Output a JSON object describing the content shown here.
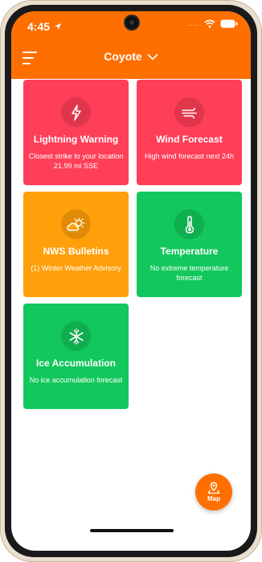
{
  "status": {
    "time": "4:45",
    "signal_dots": "...."
  },
  "header": {
    "location": "Coyote"
  },
  "cards": [
    {
      "title": "Lightning Warning",
      "description": "Closest strike to your location 21.99 mi SSE",
      "icon": "lightning-icon",
      "color": "#ff3e57"
    },
    {
      "title": "Wind Forecast",
      "description": "High wind forecast next 24h",
      "icon": "wind-icon",
      "color": "#ff3e57"
    },
    {
      "title": "NWS Bulletins",
      "description": "(1) Winter Weather Advisory",
      "icon": "partly-sunny-icon",
      "color": "#ff9f0a"
    },
    {
      "title": "Temperature",
      "description": "No extreme temperature forecast",
      "icon": "thermometer-icon",
      "color": "#12c75b"
    },
    {
      "title": "Ice Accumulation",
      "description": "No ice accumulation forecast",
      "icon": "snowflake-icon",
      "color": "#12c75b"
    }
  ],
  "fab": {
    "label": "Map",
    "icon": "map-pin-icon"
  },
  "colors": {
    "header": "#ff6f00"
  }
}
